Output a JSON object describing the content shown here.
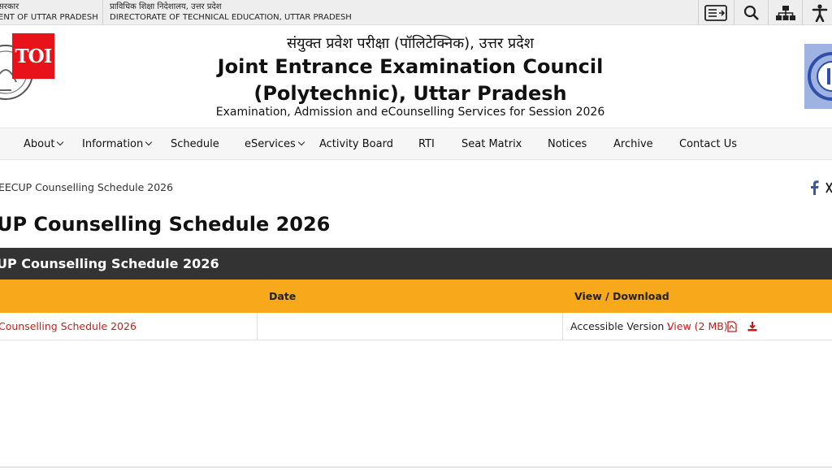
{
  "topbar": {
    "gov_left_line1": "सरकार",
    "gov_left_line2": "ENT OF UTTAR PRADESH",
    "gov_right_line1": "प्राविधिक शिक्षा निदेशालय, उत्तर प्रदेश",
    "gov_right_line2": "DIRECTORATE OF TECHNICAL EDUCATION, UTTAR PRADESH",
    "tools": [
      "skip-to-content-icon",
      "search-icon",
      "sitemap-icon",
      "accessibility-icon"
    ]
  },
  "header": {
    "toi_badge": "TOI",
    "hindi_title": "संयुक्त प्रवेश परीक्षा (पॉलिटेक्निक), उत्तर प्रदेश",
    "title_line1": "Joint Entrance Examination Council",
    "title_line2": "(Polytechnic), Uttar Pradesh",
    "subtitle": "Examination, Admission and eCounselling Services for Session 2026"
  },
  "nav": {
    "items": [
      {
        "label": "About",
        "dropdown": true
      },
      {
        "label": "Information",
        "dropdown": true
      },
      {
        "label": "Schedule",
        "dropdown": false
      },
      {
        "label": "eServices",
        "dropdown": true
      },
      {
        "label": "Activity Board",
        "dropdown": false
      },
      {
        "label": "RTI",
        "dropdown": false
      },
      {
        "label": "Seat Matrix",
        "dropdown": false
      },
      {
        "label": "Notices",
        "dropdown": false
      },
      {
        "label": "Archive",
        "dropdown": false
      },
      {
        "label": "Contact Us",
        "dropdown": false
      }
    ]
  },
  "breadcrumb": "EECUP Counselling Schedule 2026",
  "page_title": "UP Counselling Schedule 2026",
  "table": {
    "heading": "UP Counselling Schedule 2026",
    "columns": {
      "date": "Date",
      "view": "View / Download"
    },
    "rows": [
      {
        "title": "Counselling Schedule 2026",
        "date": "",
        "accessible_label": "Accessible Version : ",
        "view_link": "View (2 MB)"
      }
    ]
  },
  "colors": {
    "accent": "#f7a81b",
    "dark_band": "#333333",
    "link": "#c41f1f",
    "toi_red": "#e8131a",
    "facebook": "#3b5998"
  }
}
